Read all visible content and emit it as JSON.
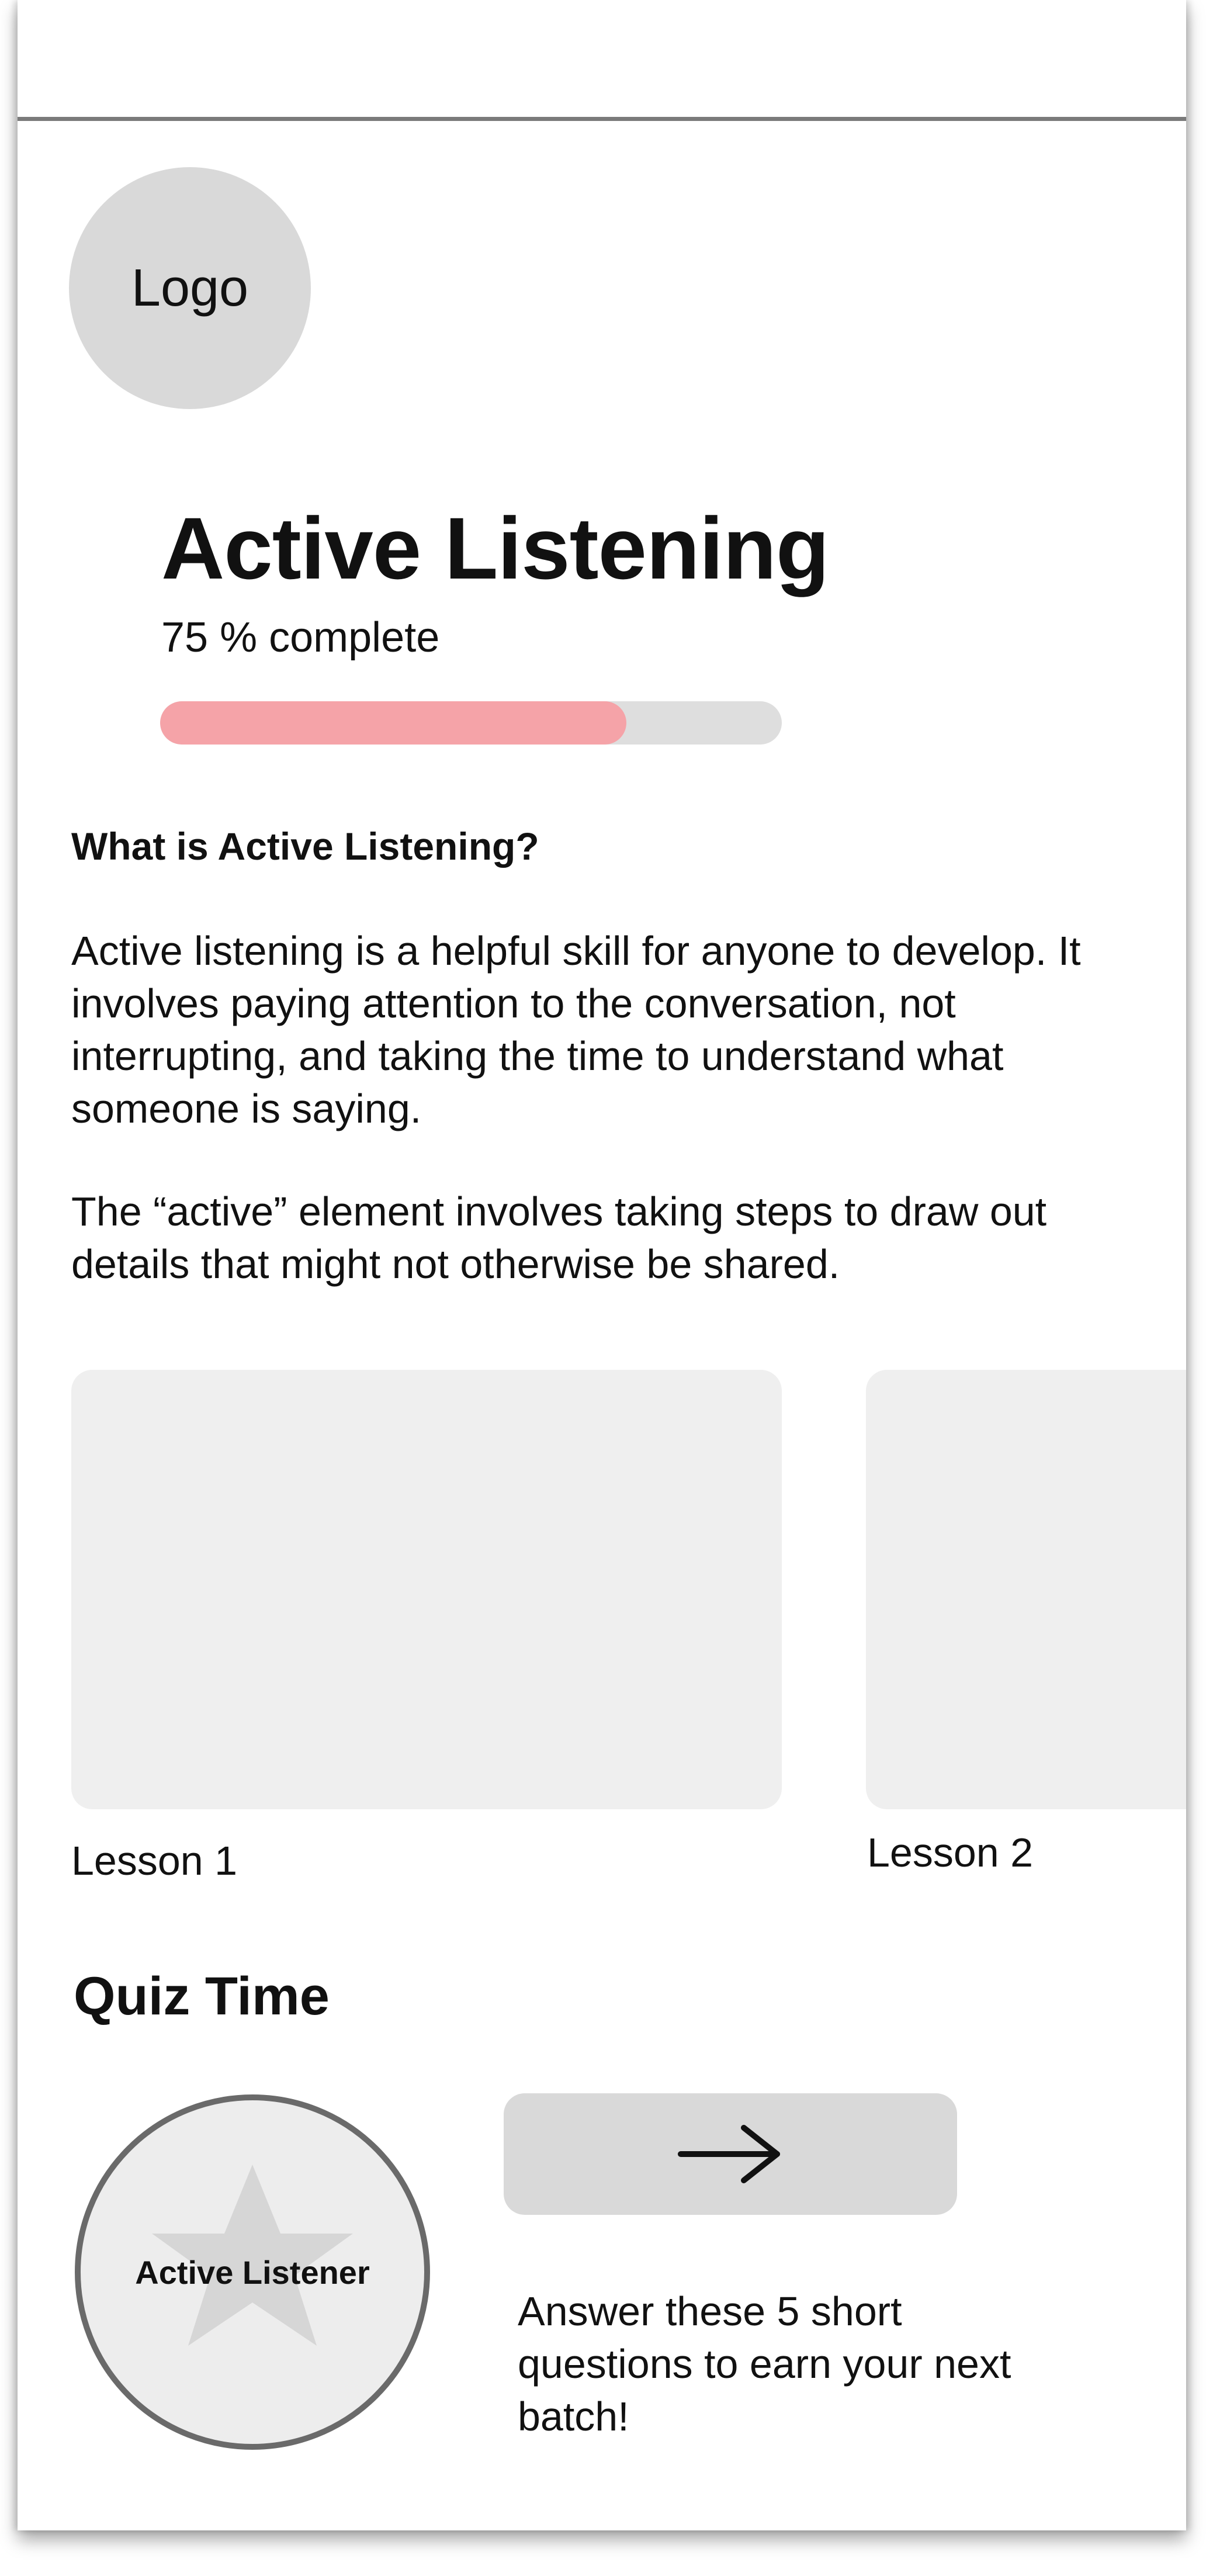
{
  "logo": {
    "text": "Logo"
  },
  "course": {
    "title": "Active Listening",
    "progress_label": "75 % complete",
    "progress_fraction": 0.75,
    "progress_color": "#f5a3a8",
    "track_color": "#dedede"
  },
  "intro": {
    "heading": "What is Active Listening?",
    "paragraphs": [
      "Active listening is a helpful skill for anyone to develop. It involves paying attention to the conversation, not interrupting, and taking the time to understand what someone is saying.",
      "The “active” element involves taking steps to draw out details that might not otherwise be shared."
    ]
  },
  "lessons": [
    {
      "label": "Lesson 1"
    },
    {
      "label": "Lesson 2"
    }
  ],
  "quiz": {
    "heading": "Quiz Time",
    "badge_label": "Active Listener",
    "badge_icon": "star-icon",
    "button_icon": "arrow-right-icon",
    "description": "Answer these 5 short questions to earn your next batch!"
  }
}
